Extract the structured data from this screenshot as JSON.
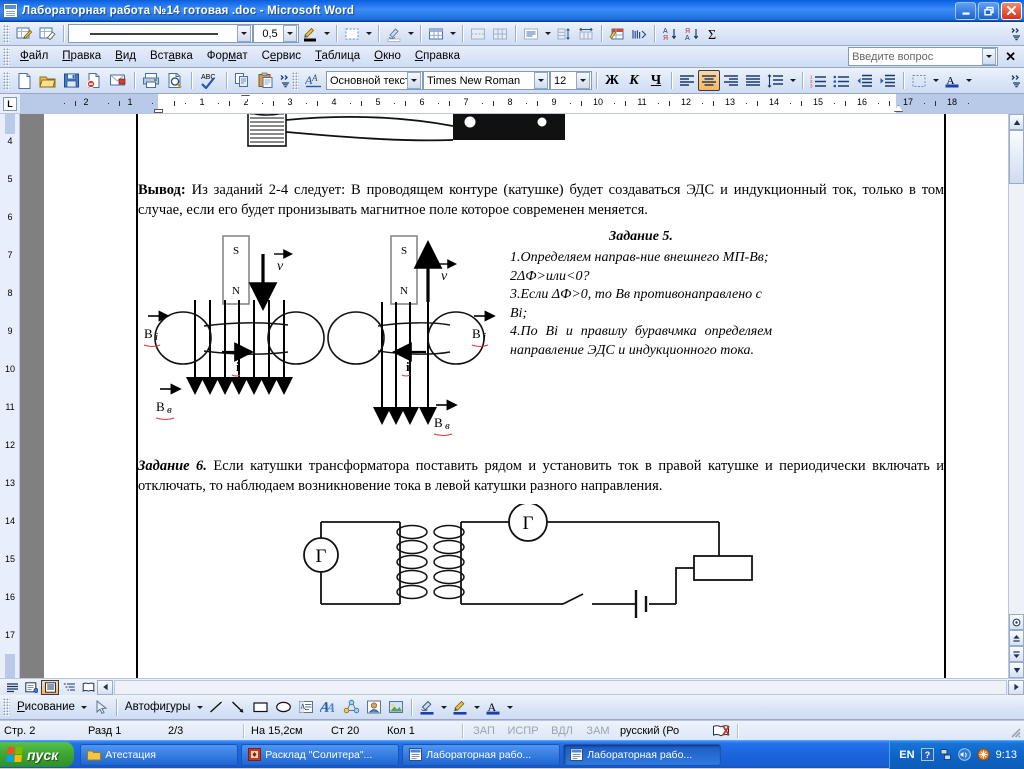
{
  "window": {
    "title": "Лабораторная работа №14 готовая .doc - Microsoft Word",
    "icon": "word-document-icon",
    "minimize": "minimize-button",
    "restore": "restore-button",
    "close": "close-button"
  },
  "menu": {
    "items": [
      "Файл",
      "Правка",
      "Вид",
      "Вставка",
      "Формат",
      "Сервис",
      "Таблица",
      "Окно",
      "Справка"
    ],
    "ask_placeholder": "Введите вопрос",
    "close_label": "✕"
  },
  "tables_toolbar": {
    "line_weight": "0,5",
    "buttons": [
      "draw-table-icon",
      "eraser-icon",
      "line-style-combo",
      "line-weight-combo",
      "border-color-icon",
      "borders-icon",
      "shading-color-icon",
      "insert-table-icon",
      "merge-cells-icon",
      "split-cells-icon",
      "align-icon",
      "distribute-rows-icon",
      "distribute-columns-icon",
      "table-autoformat-icon",
      "change-text-direction-icon",
      "sort-ascending-icon",
      "sort-descending-icon",
      "autosum-icon"
    ]
  },
  "standard_toolbar": {
    "buttons": [
      "new-document-icon",
      "open-icon",
      "save-icon",
      "mail-recipient-icon",
      "permission-icon",
      "print-icon",
      "print-preview-icon",
      "spelling-icon",
      "copy-icon",
      "paste-icon"
    ]
  },
  "formatting_toolbar": {
    "style": "Основной текст",
    "font": "Times New Roman",
    "size": "12",
    "bold": "Ж",
    "italic": "К",
    "underline": "Ч",
    "align_selected": "center",
    "buttons": [
      "styles-icon",
      "align-left-icon",
      "align-center-icon",
      "align-right-icon",
      "align-justify-icon",
      "line-spacing-icon",
      "numbering-icon",
      "bullets-icon",
      "decrease-indent-icon",
      "increase-indent-icon",
      "outside-border-icon",
      "highlight-icon",
      "font-color-icon"
    ]
  },
  "ruler": {
    "tab_selector": "L",
    "left_numbers": [
      "2",
      "1"
    ],
    "numbers": [
      "1",
      "2",
      "3",
      "4",
      "5",
      "6",
      "7",
      "8",
      "9",
      "10",
      "11",
      "12",
      "13",
      "14",
      "15",
      "16",
      "17",
      "18"
    ],
    "vertical_numbers": [
      "4",
      "5",
      "6",
      "7",
      "8",
      "9",
      "10",
      "11",
      "12",
      "13",
      "14",
      "15",
      "16",
      "17"
    ]
  },
  "document": {
    "conclusion": {
      "lead": "Вывод:",
      "text": " Из заданий 2-4 следует: В проводящем контуре (катушке) будет создаваться ЭДС и индукционный ток, только в том случае, если его будет пронизывать магнитное поле которое современен меняется."
    },
    "task5": {
      "heading": "Задание 5.",
      "lines": [
        "1.Определяем направ-ние  внешнего  МП-Вв;",
        "2ΔФ>или<0?",
        "3.Если ΔФ>0, то Вв противонаправлено с Вi;",
        "4.По  Вi  и  правилу  буравчмка  определяем направление ЭДС и индукционного тока."
      ]
    },
    "figure5": {
      "name": "magnet-coil-induction-diagram",
      "labels": {
        "pole_top": "S",
        "pole_bottom": "N",
        "velocity": "v",
        "b_induced": "Bi",
        "b_external": "Bв",
        "current": "i"
      }
    },
    "task6": {
      "heading": "Задание 6.",
      "text": " Если катушки трансформатора поставить рядом и установить ток в правой катушке и периодически включать и отключать, то наблюдаем возникновение тока в левой катушки разного направления."
    },
    "figure6": {
      "name": "transformer-circuit-diagram",
      "labels": {
        "galvanometer": "Г"
      }
    }
  },
  "drawing_toolbar": {
    "menu": "Рисование",
    "autoshapes": "Автофигуры",
    "buttons": [
      "select-objects-icon",
      "line-icon",
      "arrow-icon",
      "rectangle-icon",
      "oval-icon",
      "text-box-icon",
      "wordart-icon",
      "diagram-icon",
      "clip-art-icon",
      "picture-icon",
      "fill-color-icon",
      "line-color-icon",
      "font-color-icon"
    ]
  },
  "view_buttons": [
    "normal-view-icon",
    "web-layout-view-icon",
    "print-layout-view-icon",
    "outline-view-icon",
    "reading-layout-view-icon"
  ],
  "status_bar": {
    "page": "Стр. 2",
    "section": "Разд 1",
    "pages": "2/3",
    "at": "На 15,2см",
    "line": "Ст 20",
    "col": "Кол 1",
    "flags": [
      "ЗАП",
      "ИСПР",
      "ВДЛ",
      "ЗАМ"
    ],
    "language": "русский (Ро",
    "spell_icon": "spelling-status-icon"
  },
  "taskbar": {
    "start": "пуск",
    "items": [
      {
        "label": "Атестация",
        "icon": "folder-icon",
        "active": false
      },
      {
        "label": "Расклад \"Солитера\"...",
        "icon": "solitaire-icon",
        "active": false
      },
      {
        "label": "Лабораторная рабо...",
        "icon": "word-icon",
        "active": false
      },
      {
        "label": "Лабораторная рабо...",
        "icon": "word-icon",
        "active": true
      }
    ],
    "tray": {
      "language": "EN",
      "help": "help-icon",
      "network": "network-icon",
      "volume": "volume-icon",
      "antivirus": "antivirus-icon",
      "clock": "9:13"
    }
  },
  "colors": {
    "title_blue": "#1268E8",
    "toolbar_blue": "#dbe6f7",
    "selected_orange": "#ffb552",
    "taskbar_blue": "#1B64DC",
    "start_green": "#41ab36"
  }
}
